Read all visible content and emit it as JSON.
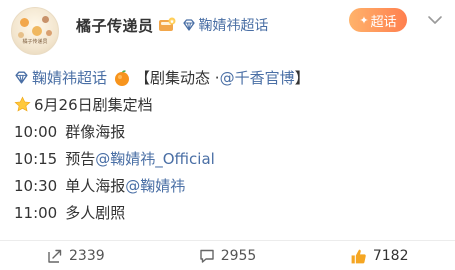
{
  "post": {
    "author": "橘子传递员",
    "topic_link": "鞠婧祎超话",
    "super_tag": "超话",
    "avatar_caption": "橘子传递员"
  },
  "content": {
    "line1": {
      "topic": "鞠婧祎超话",
      "text": "【剧集动态 · ",
      "mention": "@千香官博",
      "close": "】"
    },
    "line2": {
      "text": "6月26日剧集定档"
    },
    "line3": {
      "time": "10:00",
      "text": "群像海报"
    },
    "line4": {
      "time": "10:15",
      "text": "预告 ",
      "mention": "@鞠婧祎_Official"
    },
    "line5": {
      "time": "10:30",
      "text": "单人海报 ",
      "mention": "@鞠婧祎"
    },
    "line6": {
      "time": "11:00",
      "text": "多人剧照"
    }
  },
  "footer": {
    "repost_count": "2339",
    "comment_count": "2955",
    "like_count": "7182"
  },
  "colors": {
    "link": "#4a6fa5",
    "tag_start": "#ffb36b",
    "tag_end": "#ff7f4f",
    "like": "#f5a623"
  }
}
